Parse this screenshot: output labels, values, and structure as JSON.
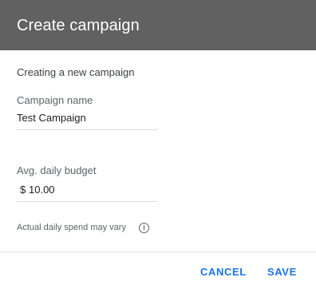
{
  "dialog": {
    "title": "Create campaign",
    "intro": "Creating a new campaign"
  },
  "fields": {
    "campaign_name": {
      "label": "Campaign name",
      "value": "Test Campaign"
    },
    "daily_budget": {
      "label": "Avg. daily budget",
      "currency_symbol": "$",
      "value": "10.00"
    }
  },
  "hint": {
    "text": "Actual daily spend may vary",
    "icon": "info-icon"
  },
  "actions": {
    "cancel_label": "CANCEL",
    "save_label": "SAVE"
  },
  "colors": {
    "header_bg": "#616161",
    "accent": "#1a73e8"
  }
}
